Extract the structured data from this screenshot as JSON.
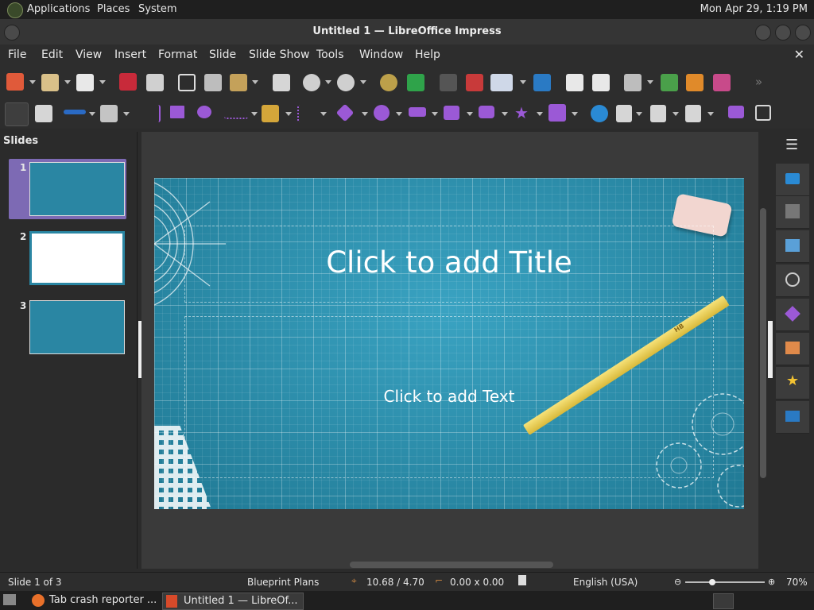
{
  "top_panel": {
    "menus": [
      "Applications",
      "Places",
      "System"
    ],
    "clock": "Mon Apr 29,  1:19 PM"
  },
  "window": {
    "title": "Untitled 1 — LibreOffice Impress"
  },
  "menubar": {
    "items": [
      "File",
      "Edit",
      "View",
      "Insert",
      "Format",
      "Slide",
      "Slide Show",
      "Tools",
      "Window",
      "Help"
    ],
    "close_label": "✕"
  },
  "slides_pane": {
    "label": "Slides",
    "thumbnails": [
      {
        "number": "1"
      },
      {
        "number": "2"
      },
      {
        "number": "3"
      }
    ]
  },
  "slide": {
    "title_placeholder": "Click to add Title",
    "text_placeholder": "Click to add Text",
    "pencil_label": "HB"
  },
  "statusbar": {
    "slide_position": "Slide 1 of 3",
    "master_name": "Blueprint Plans",
    "position": "10.68 / 4.70",
    "size": "0.00 x 0.00",
    "language": "English (USA)",
    "zoom": "70%"
  },
  "taskbar": {
    "tasks": [
      "Tab crash reporter ...",
      "Untitled 1 — LibreOf..."
    ]
  },
  "colors": {
    "slide_bg": "#2a86a3",
    "accent_purple": "#9b59d6"
  }
}
